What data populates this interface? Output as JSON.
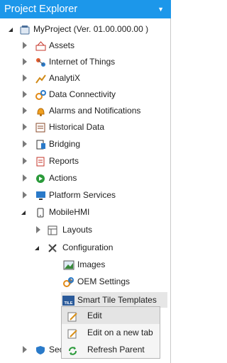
{
  "panel": {
    "title": "Project Explorer",
    "dropdown_glyph": "▼"
  },
  "tree": {
    "root": "MyProject (Ver. 01.00.000.00 )",
    "items": {
      "assets": "Assets",
      "iot": "Internet of Things",
      "analytix": "AnalytiX",
      "data_connectivity": "Data Connectivity",
      "alarms": "Alarms and Notifications",
      "historical": "Historical Data",
      "bridging": "Bridging",
      "reports": "Reports",
      "actions": "Actions",
      "platform_services": "Platform Services",
      "mobilehmi": "MobileHMI",
      "layouts": "Layouts",
      "configuration": "Configuration",
      "images": "Images",
      "oem_settings": "OEM Settings",
      "smart_tile_templates": "Smart Tile Templates",
      "security_partial": "Sec"
    },
    "tile_badge": "TILE"
  },
  "context_menu": {
    "edit": "Edit",
    "edit_new_tab": "Edit on a new tab",
    "refresh_parent": "Refresh Parent"
  }
}
